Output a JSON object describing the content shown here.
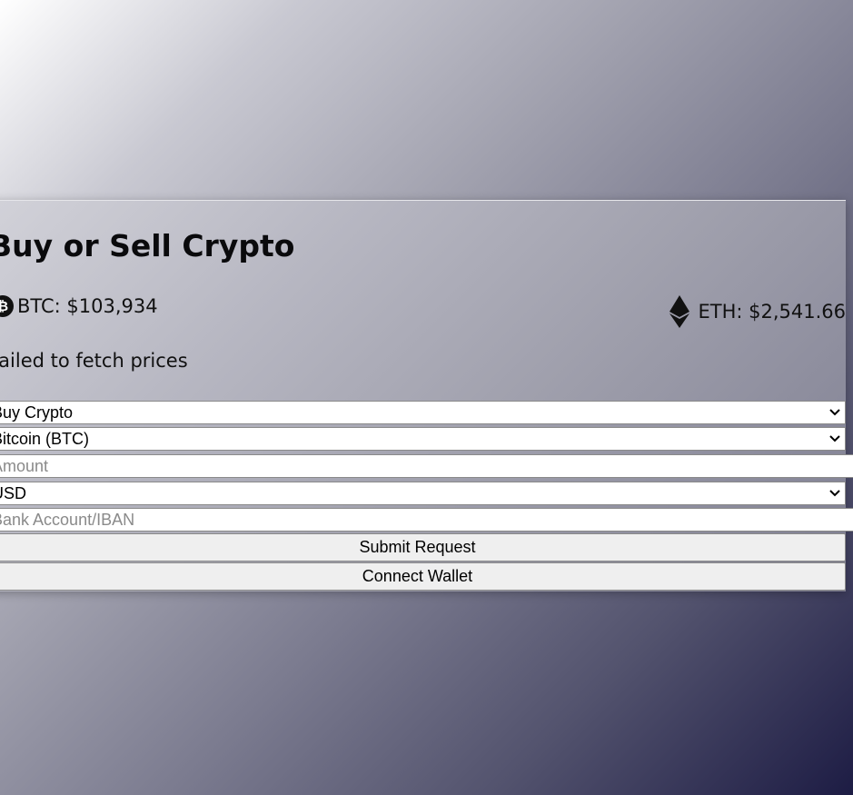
{
  "form": {
    "title": "Buy or Sell Crypto",
    "btc_price": "BTC: $103,934",
    "eth_price": "ETH: $2,541.66",
    "error": "Failed to fetch prices",
    "action_select": "Buy Crypto",
    "coin_select": "Bitcoin (BTC)",
    "amount_placeholder": "Amount",
    "currency_select": "USD",
    "bank_placeholder": "Bank Account/IBAN",
    "submit_label": "Submit Request",
    "connect_label": "Connect Wallet"
  },
  "icons": {
    "btc": "bitcoin-icon",
    "eth": "ethereum-icon",
    "chevron": "chevron-down-icon"
  }
}
